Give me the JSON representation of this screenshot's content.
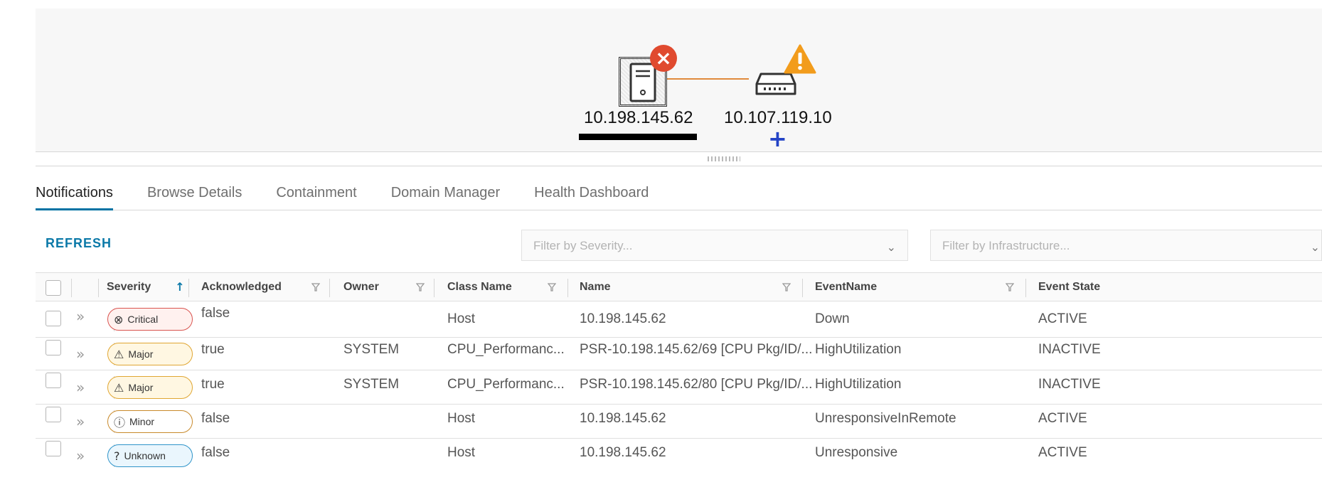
{
  "topology": {
    "host_label": "10.198.145.62",
    "switch_label": "10.107.119.10",
    "host_icon": "server-icon",
    "switch_icon": "network-switch-icon",
    "host_status_icon": "critical-x-icon",
    "switch_status_icon": "warning-triangle-icon",
    "expand_symbol": "+",
    "colors": {
      "link": "#e08a3c",
      "critical": "#e04a2f",
      "warning": "#f29c1c",
      "expand": "#2343c6"
    }
  },
  "tabs": [
    {
      "label": "Notifications",
      "active": true
    },
    {
      "label": "Browse Details",
      "active": false
    },
    {
      "label": "Containment",
      "active": false
    },
    {
      "label": "Domain Manager",
      "active": false
    },
    {
      "label": "Health Dashboard",
      "active": false
    }
  ],
  "toolbar": {
    "refresh_label": "REFRESH",
    "severity_filter_placeholder": "Filter by Severity...",
    "infrastructure_filter_placeholder": "Filter by Infrastructure..."
  },
  "table": {
    "columns": [
      "Severity",
      "Acknowledged",
      "Owner",
      "Class Name",
      "Name",
      "EventName",
      "Event State"
    ],
    "sort": {
      "column": "Severity",
      "direction": "ascending"
    },
    "rows": [
      {
        "severity": "Critical",
        "severity_icon": "⊗",
        "acknowledged": "false",
        "owner": "",
        "class_name": "Host",
        "name": "10.198.145.62",
        "event_name": "Down",
        "event_state": "ACTIVE"
      },
      {
        "severity": "Major",
        "severity_icon": "⚠",
        "acknowledged": "true",
        "owner": "SYSTEM",
        "class_name": "CPU_Performanc...",
        "name": "PSR-10.198.145.62/69 [CPU Pkg/ID/...",
        "event_name": "HighUtilization",
        "event_state": "INACTIVE"
      },
      {
        "severity": "Major",
        "severity_icon": "⚠",
        "acknowledged": "true",
        "owner": "SYSTEM",
        "class_name": "CPU_Performanc...",
        "name": "PSR-10.198.145.62/80 [CPU Pkg/ID/...",
        "event_name": "HighUtilization",
        "event_state": "INACTIVE"
      },
      {
        "severity": "Minor",
        "severity_icon": "ⓘ",
        "acknowledged": "false",
        "owner": "",
        "class_name": "Host",
        "name": "10.198.145.62",
        "event_name": "UnresponsiveInRemote",
        "event_state": "ACTIVE"
      },
      {
        "severity": "Unknown",
        "severity_icon": "?",
        "acknowledged": "false",
        "owner": "",
        "class_name": "Host",
        "name": "10.198.145.62",
        "event_name": "Unresponsive",
        "event_state": "ACTIVE"
      }
    ]
  }
}
